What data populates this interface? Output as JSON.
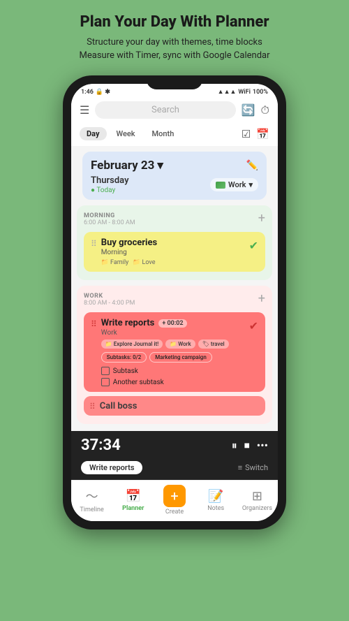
{
  "page": {
    "title": "Plan Your Day With Planner",
    "subtitle": "Structure your day with themes, time blocks\nMeasure with Timer, sync with Google Calendar"
  },
  "status_bar": {
    "time": "1:46",
    "battery": "100%"
  },
  "search": {
    "placeholder": "Search"
  },
  "view_tabs": {
    "tabs": [
      "Day",
      "Week",
      "Month"
    ],
    "active": "Day"
  },
  "date_header": {
    "date": "February 23",
    "day": "Thursday",
    "today_label": "Today",
    "work_label": "Work"
  },
  "morning_section": {
    "title": "MORNING",
    "time": "6:00 AM - 8:00 AM",
    "task": {
      "title": "Buy groceries",
      "subtitle": "Morning",
      "tags": [
        "Family",
        "Love"
      ]
    }
  },
  "work_section": {
    "title": "WORK",
    "time": "8:00 AM - 4:00 PM",
    "task1": {
      "title": "Write reports",
      "subtitle": "Work",
      "timer_label": "+ 00:02",
      "tags": [
        "Explore Journal it!",
        "Work",
        "travel"
      ],
      "subtask_pills": [
        "Subtasks: 0/2",
        "Marketing campaign"
      ],
      "subtasks": [
        "Subtask",
        "Another subtask"
      ]
    },
    "task2": {
      "title": "Call boss"
    }
  },
  "timer": {
    "time": "37:34",
    "task_label": "Write reports"
  },
  "bottom_nav": {
    "items": [
      {
        "icon": "timeline",
        "label": "Timeline"
      },
      {
        "icon": "planner",
        "label": "Planner",
        "active": true
      },
      {
        "icon": "create",
        "label": "Create"
      },
      {
        "icon": "notes",
        "label": "Notes"
      },
      {
        "icon": "organizers",
        "label": "Organizers"
      }
    ],
    "switch_label": "Switch"
  }
}
